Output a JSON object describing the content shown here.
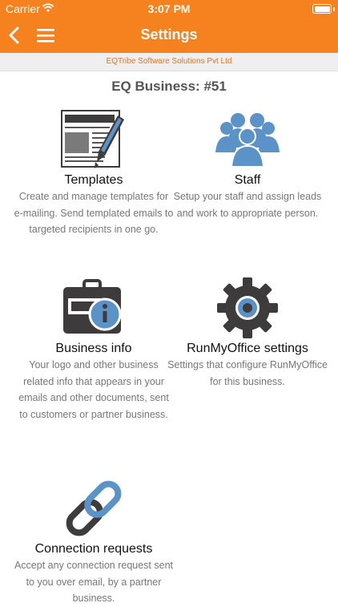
{
  "status_bar": {
    "carrier": "Carrier",
    "time": "3:07 PM"
  },
  "nav": {
    "title": "Settings"
  },
  "company": "EQTribe Software Solutions Pvt Ltd",
  "business_title": "EQ Business: #51",
  "tiles": [
    {
      "title": "Templates",
      "description": "Create and manage templates for e-mailing. Send templated emails to targeted recipients in one go.",
      "icon": "templates-icon"
    },
    {
      "title": "Staff",
      "description": "Setup your staff and assign leads and work to appropriate person.",
      "icon": "staff-icon"
    },
    {
      "title": "Business info",
      "description": "Your logo and other business related info that appears in your emails and other documents, sent to customers or partner business.",
      "icon": "business-info-icon"
    },
    {
      "title": "RunMyOffice settings",
      "description": "Settings that configure RunMyOffice for this business.",
      "icon": "gear-icon"
    },
    {
      "title": "Connection requests",
      "description": "Accept any connection request sent to you over email, by a partner business.",
      "icon": "link-icon"
    }
  ],
  "colors": {
    "accent": "#f5821f",
    "icon_dark": "#3d3b3b",
    "icon_blue": "#5b93c8"
  }
}
